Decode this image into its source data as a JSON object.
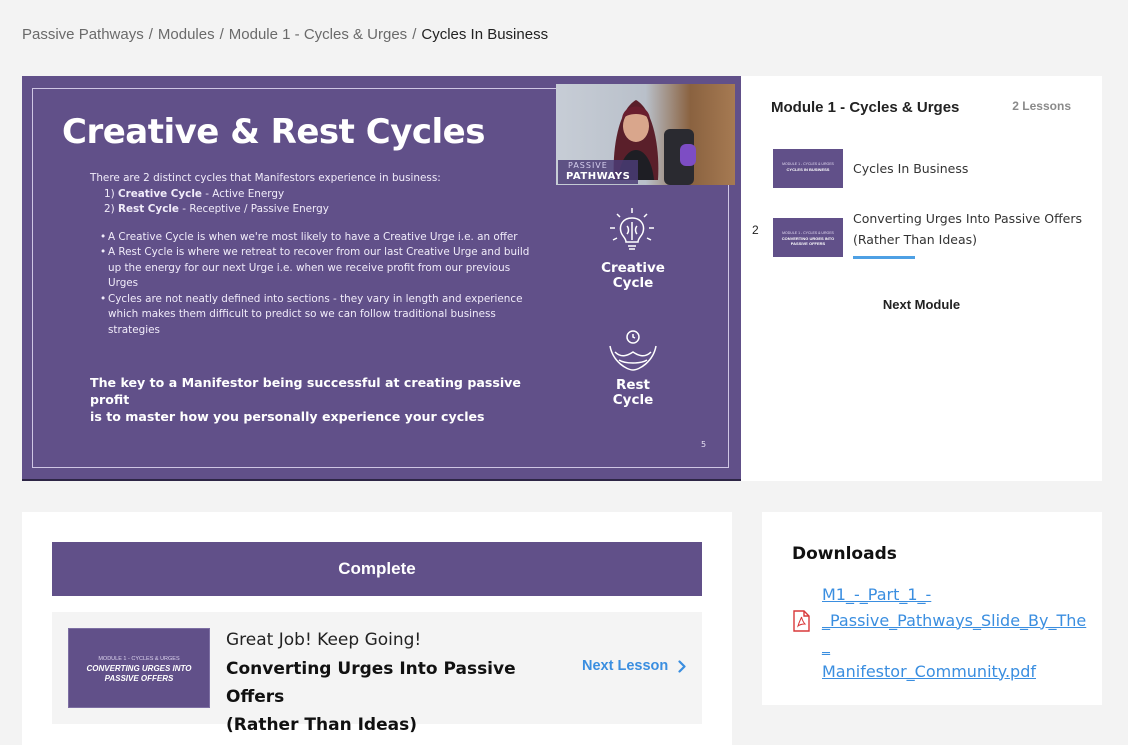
{
  "breadcrumb": {
    "items": [
      "Passive Pathways",
      "Modules",
      "Module 1 - Cycles & Urges"
    ],
    "current": "Cycles In Business"
  },
  "slide": {
    "title": "Creative & Rest Cycles",
    "intro": "There are 2 distinct cycles that Manifestors experience in business:",
    "cycles": [
      {
        "num": "1)",
        "name": "Creative Cycle",
        "desc": "- Active Energy"
      },
      {
        "num": "2)",
        "name": "Rest Cycle",
        "desc": "- Receptive / Passive Energy"
      }
    ],
    "bullets": [
      "A Creative Cycle is when we're most likely to have a Creative Urge i.e. an offer",
      "A Rest Cycle is where we retreat to recover from our last Creative Urge and build up the energy for our next Urge i.e. when we receive profit from our previous Urges",
      "Cycles are not neatly defined into sections - they vary in length and experience which makes them difficult to predict so we can follow traditional business strategies"
    ],
    "key_line1": "The key to a Manifestor being successful at creating passive profit",
    "key_line2": "is to master how you personally experience your cycles",
    "webcam_overlay_top": "PASSIVE",
    "webcam_overlay_bottom": "PATHWAYS",
    "creative_label_1": "Creative",
    "creative_label_2": "Cycle",
    "rest_label_1": "Rest",
    "rest_label_2": "Cycle",
    "page_number": "5"
  },
  "module": {
    "title": "Module 1 - Cycles & Urges",
    "lesson_count": "2 Lessons",
    "lessons": [
      {
        "index": "",
        "label": "Cycles In Business",
        "thumb_top": "MODULE 1 - CYCLES & URGES",
        "thumb_main": "CYCLES IN BUSINESS"
      },
      {
        "index": "2",
        "label_line1": "Converting Urges Into Passive Offers",
        "label_line2": "(Rather Than Ideas)",
        "thumb_top": "MODULE 1 - CYCLES & URGES",
        "thumb_main": "CONVERTING URGES INTO PASSIVE OFFERS"
      }
    ],
    "next_module": "Next Module"
  },
  "complete": {
    "button": "Complete",
    "encouragement": "Great Job! Keep Going!",
    "next_title_line1": "Converting Urges Into Passive Offers",
    "next_title_line2": "(Rather Than Ideas)",
    "next_lesson": "Next Lesson",
    "thumb_top": "MODULE 1 - CYCLES & URGES",
    "thumb_line1": "CONVERTING URGES INTO",
    "thumb_line2": "PASSIVE OFFERS"
  },
  "downloads": {
    "title": "Downloads",
    "file_line1": "M1_-_Part_1_-",
    "file_line2": "_Passive_Pathways_Slide_By_The_",
    "file_line3": "Manifestor_Community.pdf"
  },
  "colors": {
    "brand_purple": "#615089",
    "link_blue": "#3a8ee0",
    "progress_blue": "#4ea0e4",
    "pdf_red": "#d9383a"
  }
}
